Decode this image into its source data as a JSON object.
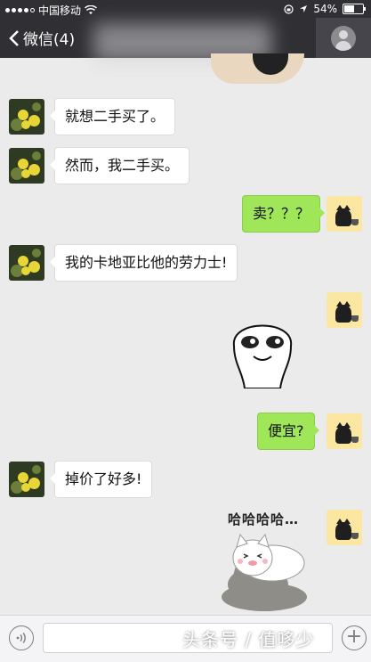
{
  "status_bar": {
    "carrier": "中国移动",
    "battery": "54%",
    "battery_fraction": 0.54,
    "signal_filled": 4,
    "signal_total": 5
  },
  "nav": {
    "back_label": "微信(4)",
    "back_icon": "chevron-left-icon",
    "profile_icon": "person-icon"
  },
  "messages": [
    {
      "side": "in",
      "text": "就想二手买了。"
    },
    {
      "side": "in",
      "text": "然而，我二手买。"
    },
    {
      "side": "out",
      "text": "卖？？？"
    },
    {
      "side": "in",
      "text": "我的卡地亚比他的劳力士!"
    },
    {
      "side": "out",
      "sticker": "smiling-face-sticker"
    },
    {
      "side": "out",
      "text": "便宜?"
    },
    {
      "side": "in",
      "text": "掉价了好多!"
    },
    {
      "side": "out",
      "sticker": "laughing-cats-sticker",
      "sticker_text": "哈哈哈哈…"
    }
  ],
  "input_bar": {
    "voice_icon": "voice-icon",
    "plus_icon": "plus-icon",
    "plus_glyph": "+"
  },
  "watermark": "头条号 / 值哆少",
  "colors": {
    "header_bg": "#2f2f34",
    "chat_bg": "#ebebeb",
    "outgoing_bubble": "#9fe658",
    "incoming_bubble": "#ffffff"
  }
}
